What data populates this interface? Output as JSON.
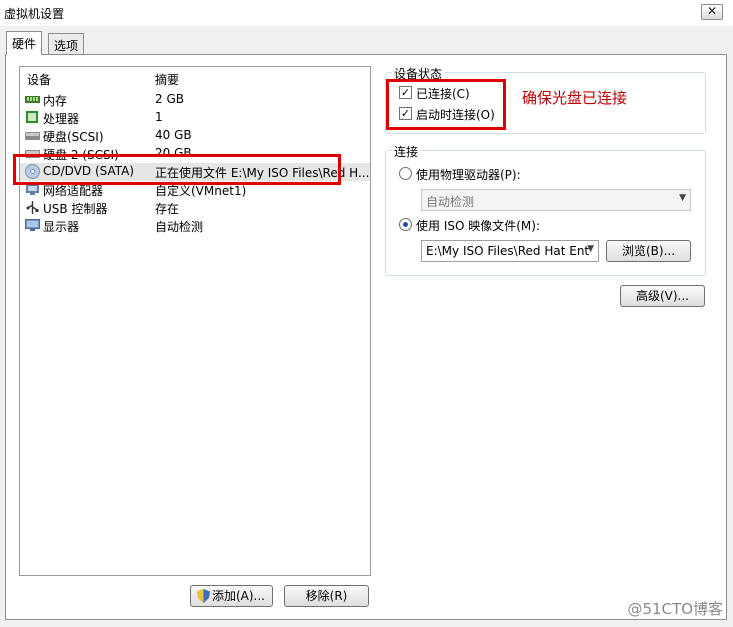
{
  "window": {
    "title": "虚拟机设置",
    "close_glyph": "✕"
  },
  "tabs": [
    {
      "label": "硬件",
      "active": true
    },
    {
      "label": "选项",
      "active": false
    }
  ],
  "device_table": {
    "headers": {
      "device": "设备",
      "summary": "摘要"
    },
    "rows": [
      {
        "name": "内存",
        "summary": "2 GB",
        "icon": "memory-icon"
      },
      {
        "name": "处理器",
        "summary": "1",
        "icon": "processor-icon"
      },
      {
        "name": "硬盘(SCSI)",
        "summary": "40 GB",
        "icon": "hard-disk-icon"
      },
      {
        "name": "硬盘 2 (SCSI)",
        "summary": "20 GB",
        "icon": "hard-disk-icon"
      },
      {
        "name": "CD/DVD (SATA)",
        "summary": "正在使用文件 E:\\My ISO Files\\Red H...",
        "icon": "cd-dvd-icon",
        "selected": true
      },
      {
        "name": "网络适配器",
        "summary": "自定义(VMnet1)",
        "icon": "network-adapter-icon"
      },
      {
        "name": "USB 控制器",
        "summary": "存在",
        "icon": "usb-icon"
      },
      {
        "name": "显示器",
        "summary": "自动检测",
        "icon": "display-icon"
      }
    ]
  },
  "buttons": {
    "add": "添加(A)...",
    "remove": "移除(R)",
    "browse": "浏览(B)...",
    "advanced": "高级(V)..."
  },
  "device_status": {
    "label": "设备状态",
    "connected": {
      "label": "已连接(C)",
      "checked": true
    },
    "connect_at_power_on": {
      "label": "启动时连接(O)",
      "checked": true
    }
  },
  "annotation": "确保光盘已连接",
  "connection": {
    "label": "连接",
    "physical_drive": {
      "label": "使用物理驱动器(P):",
      "selected": false
    },
    "physical_drive_select": "自动检测",
    "iso_image": {
      "label": "使用 ISO 映像文件(M):",
      "selected": true
    },
    "iso_path": "E:\\My ISO Files\\Red Hat Ent"
  },
  "watermark": "@51CTO博客",
  "colors": {
    "annotation_red": "#dd0000",
    "radio_accent": "#1b4fa8"
  }
}
